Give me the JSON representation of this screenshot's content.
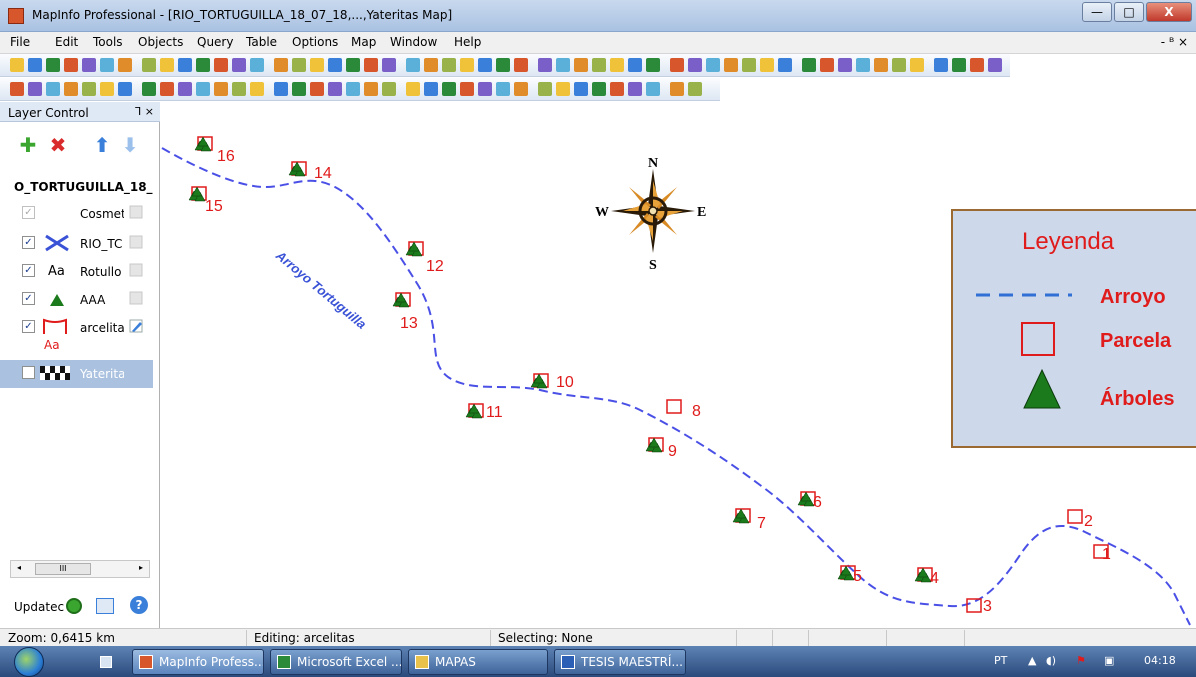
{
  "window": {
    "title": "MapInfo Professional - [RIO_TORTUGUILLA_18_07_18,...,Yateritas Map]",
    "minimize": "—",
    "maximize": "□",
    "close": "X"
  },
  "menu": {
    "items": [
      "File",
      "Edit",
      "Tools",
      "Objects",
      "Query",
      "Table",
      "Options",
      "Map",
      "Window",
      "Help"
    ],
    "mdi_controls": "- ᴮ ×"
  },
  "layer_control": {
    "title": "Layer Control",
    "controls": "⅂ ×",
    "map_name": "O_TORTUGUILLA_18_",
    "layers": [
      {
        "label": "Cosmet",
        "checked": true,
        "enabled": false,
        "icon": "cosmetic-layer-icon"
      },
      {
        "label": "RIO_TC",
        "checked": true,
        "enabled": true,
        "icon": "river-line-icon"
      },
      {
        "label": "Rotullo",
        "checked": true,
        "enabled": true,
        "icon": "label-aa-icon",
        "icon_text": "Aa"
      },
      {
        "label": "AAA",
        "checked": true,
        "enabled": true,
        "icon": "tree-triangle-icon"
      },
      {
        "label": "arcelita",
        "checked": true,
        "enabled": true,
        "icon": "parcel-rect-icon",
        "sub_icon_text": "Aa"
      },
      {
        "label": "Yaterita",
        "checked": false,
        "enabled": true,
        "icon": "raster-checker-icon",
        "selected": true
      }
    ],
    "scroll_thumb": "III",
    "update_label": "Updatec"
  },
  "map": {
    "compass": {
      "n": "N",
      "s": "S",
      "e": "E",
      "w": "W"
    },
    "river_label": "Arroyo Tortuguilla",
    "legend": {
      "title": "Leyenda",
      "items": [
        {
          "label": "Arroyo",
          "symbol": "dashed-line"
        },
        {
          "label": "Parcela",
          "symbol": "red-square"
        },
        {
          "label": "Árboles",
          "symbol": "green-triangle"
        }
      ]
    },
    "plots": [
      {
        "id": "1",
        "trees": false
      },
      {
        "id": "2",
        "trees": false
      },
      {
        "id": "3",
        "trees": false
      },
      {
        "id": "4",
        "trees": true
      },
      {
        "id": "5",
        "trees": true
      },
      {
        "id": "6",
        "trees": true
      },
      {
        "id": "7",
        "trees": true
      },
      {
        "id": "8",
        "trees": false
      },
      {
        "id": "9",
        "trees": true
      },
      {
        "id": "10",
        "trees": true
      },
      {
        "id": "11",
        "trees": true
      },
      {
        "id": "12",
        "trees": true
      },
      {
        "id": "13",
        "trees": true
      },
      {
        "id": "14",
        "trees": true
      },
      {
        "id": "15",
        "trees": true
      },
      {
        "id": "16",
        "trees": true
      }
    ],
    "colors": {
      "river": "#4a50e6",
      "plot": "#e01b1b",
      "tree": "#1b7a1b",
      "legend_bg": "#cdd9ea",
      "legend_border": "#9a6a32",
      "legend_title": "#e01b1b"
    }
  },
  "status": {
    "zoom": "Zoom: 0,6415 km",
    "editing": "Editing: arcelitas",
    "selecting": "Selecting: None"
  },
  "taskbar": {
    "buttons": [
      {
        "label": "MapInfo Profess...",
        "active": true
      },
      {
        "label": "Microsoft Excel ...",
        "active": false
      },
      {
        "label": "MAPAS",
        "active": false
      },
      {
        "label": "TESIS MAESTRÍ...",
        "active": false
      }
    ],
    "language": "PT",
    "clock": "04:18"
  }
}
